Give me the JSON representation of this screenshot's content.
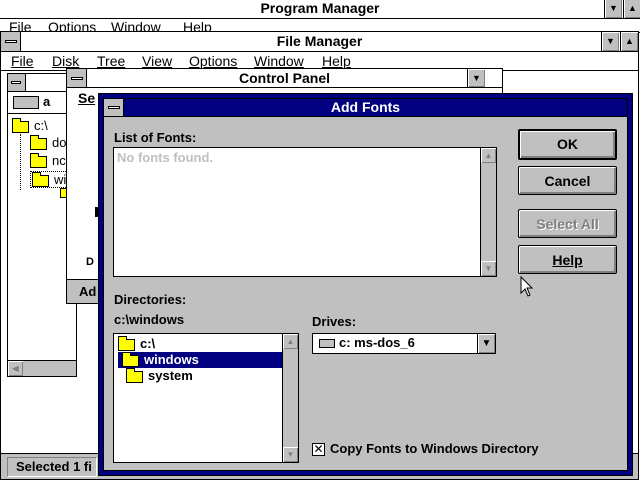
{
  "program_manager": {
    "title": "Program Manager",
    "menu": [
      "File",
      "Options",
      "Window",
      "Help"
    ]
  },
  "file_manager": {
    "title": "File Manager",
    "menu": [
      "File",
      "Disk",
      "Tree",
      "View",
      "Options",
      "Window",
      "Help"
    ],
    "drive_label": "a",
    "tree_root": "c:\\",
    "tree_items": [
      "do",
      "nc",
      "wi"
    ],
    "status": "Selected 1 fi"
  },
  "control_panel": {
    "title": "Control Panel",
    "menu_fragment": "Se",
    "left_fragment": "D",
    "add_fragment": "Ad"
  },
  "add_fonts": {
    "title": "Add Fonts",
    "list_of_fonts_label": "List of Fonts:",
    "list_of_fonts_empty": "No fonts found.",
    "directories_label": "Directories:",
    "current_path": "c:\\windows",
    "directories": [
      {
        "name": "c:\\",
        "state": "open"
      },
      {
        "name": "windows",
        "state": "open-selected"
      },
      {
        "name": "system",
        "state": "closed"
      }
    ],
    "drives_label": "Drives:",
    "drive_selected": "c: ms-dos_6",
    "copy_checkbox_label": "Copy Fonts to Windows Directory",
    "copy_checked": true,
    "buttons": {
      "ok": "OK",
      "cancel": "Cancel",
      "select_all": "Select All",
      "help": "Help"
    }
  },
  "colors": {
    "active_title": "#000080",
    "button_face": "#c0c0c0",
    "disabled_text": "#808080"
  }
}
